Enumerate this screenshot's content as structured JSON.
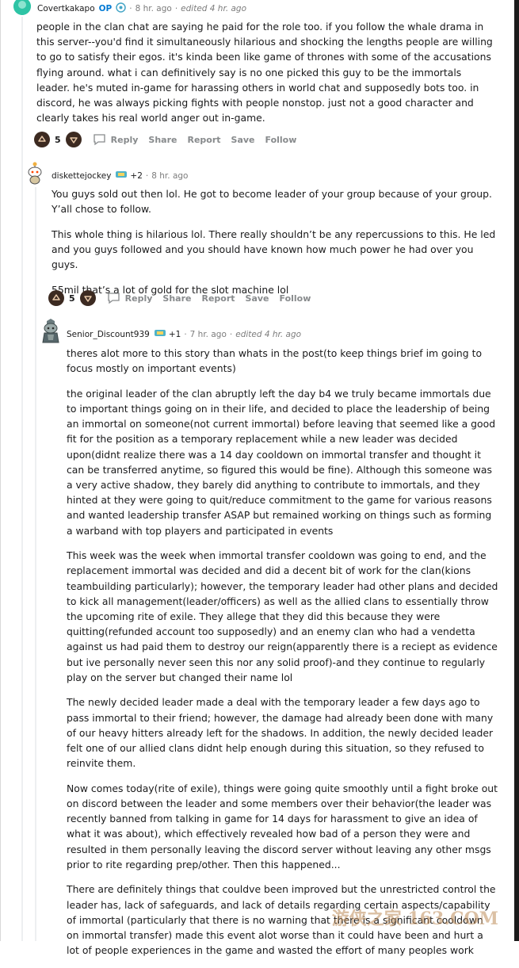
{
  "comments": [
    {
      "username": "Covertkakapo",
      "op_badge": "OP",
      "time": "8 hr. ago",
      "edited": "edited 4 hr. ago",
      "paragraphs": [
        "people in the clan chat are saying he paid for the role too. if you follow the whale drama in this server--you'd find it simultaneously hilarious and shocking the lengths people are willing to go to satisfy their egos. it's kinda been like game of thrones with some of the accusations flying around. what i can definitively say is no one picked this guy to be the immortals leader. he's muted in-game for harassing others in world chat and supposedly bots too. in discord, he was always picking fights with people nonstop. just not a good character and clearly takes his real world anger out in-game."
      ],
      "votes": "5",
      "actions": [
        "Reply",
        "Share",
        "Report",
        "Save",
        "Follow"
      ]
    },
    {
      "username": "diskettejockey",
      "flair_plus": "+2",
      "time": "8 hr. ago",
      "paragraphs": [
        "You guys sold out then lol. He got to become leader of your group because of your group. Y’all chose to follow.",
        "This whole thing is hilarious lol. There really shouldn’t be any repercussions to this. He led and you guys followed and you should have known how much power he had over you guys.",
        "55mil that’s a lot of gold for the slot machine lol"
      ],
      "votes": "5",
      "actions": [
        "Reply",
        "Share",
        "Report",
        "Save",
        "Follow"
      ]
    },
    {
      "username": "Senior_Discount939",
      "flair_plus": "+1",
      "time": "7 hr. ago",
      "edited": "edited 4 hr. ago",
      "paragraphs": [
        "theres alot more to this story than whats in the post(to keep things brief im going to focus mostly on important events)",
        "the original leader of the clan abruptly left the day b4 we truly became immortals due to important things going on in their life, and decided to place the leadership of being an immortal on someone(not current immortal) before leaving that seemed like a good fit for the position as a temporary replacement while a new leader was decided upon(didnt realize there was a 14 day cooldown on immortal transfer and thought it can be transferred anytime, so figured this would be fine). Although this someone was a very active shadow, they barely did anything to contribute to immortals, and they hinted at they were going to quit/reduce commitment to the game for various reasons and wanted leadership transfer ASAP but remained working on things such as forming a warband with top players and participated in events",
        "This week was the week when immortal transfer cooldown was going to end, and the replacement immortal was decided and did a decent bit of work for the clan(kions teambuilding particularly); however, the temporary leader had other plans and decided to kick all management(leader/officers) as well as the allied clans to essentially throw the upcoming rite of exile. They allege that they did this because they were quitting(refunded account too supposedly) and an enemy clan who had a vendetta against us had paid them to destroy our reign(apparently there is a reciept as evidence but ive personally never seen this nor any solid proof)-and they continue to regularly play on the server but changed their name lol",
        "The newly decided leader made a deal with the temporary leader a few days ago to pass immortal to their friend; however, the damage had already been done with many of our heavy hitters already left for the shadows. In addition, the newly decided leader felt one of our allied clans didnt help enough during this situation, so they refused to reinvite them.",
        "Now comes today(rite of exile), things were going quite smoothly until a fight broke out on discord between the leader and some members over their behavior(the leader was recently banned from talking in game for 14 days for harassment to give an idea of what it was about), which effectively revealed how bad of a person they were and resulted in them personally leaving the discord server without leaving any other msgs prior to rite regarding prep/other. Then this happened...",
        "There are definitely things that couldve been improved but the unrestricted control the leader has, lack of safeguards, and lack of details regarding certain aspects/capability of immortal (particularly that there is no warning that there is a significant cooldown on immortal transfer) made this event alot worse than it could have been and hurt a lot of people experiences in the game and wasted the effort of many peoples work"
      ]
    }
  ],
  "watermark": "游侠之家 163.COM",
  "colors": {
    "accent": "#0079d3",
    "vote_bg": "#3c2a21",
    "meta": "#7c7c7c",
    "action": "#878a8c"
  },
  "icons": {
    "upvote": "arrow-up-icon",
    "downvote": "arrow-down-icon",
    "reply": "speech-bubble-icon"
  }
}
